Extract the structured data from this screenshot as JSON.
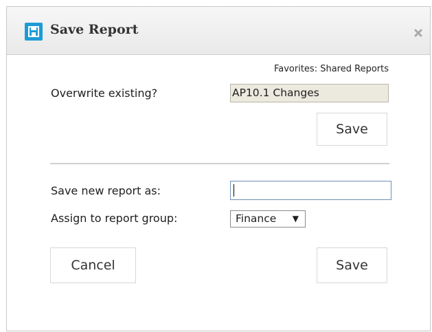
{
  "dialog": {
    "title": "Save Report",
    "app_icon": "save-disk-icon",
    "close_icon": "close-icon"
  },
  "overwrite": {
    "favorites_label": "Favorites: Shared Reports",
    "label": "Overwrite existing?",
    "existing_report": "AP10.1 Changes",
    "save_label": "Save"
  },
  "new_report": {
    "name_label": "Save new report as:",
    "name_value": "",
    "group_label": "Assign to report group:",
    "group_selected": "Finance",
    "group_arrow": "▼",
    "cancel_label": "Cancel",
    "save_label": "Save"
  },
  "colors": {
    "accent": "#1d9bd8",
    "titlebar": "#eeeeee",
    "readonly_field": "#ece9df"
  }
}
